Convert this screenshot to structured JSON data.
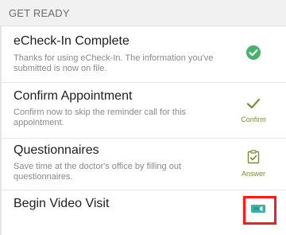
{
  "section": {
    "header": "GET READY"
  },
  "rows": [
    {
      "title": "eCheck-In Complete",
      "subtitle": "Thanks for using eCheck-In. The information you've submitted is now on file.",
      "icon": "check-circle-icon"
    },
    {
      "title": "Confirm Appointment",
      "subtitle": "Confirm now to skip the reminder call for this appointment.",
      "icon": "checkmark-icon",
      "action_label": "Confirm"
    },
    {
      "title": "Questionnaires",
      "subtitle": "Save time at the doctor's office by filling out questionnaires.",
      "icon": "clipboard-check-icon",
      "action_label": "Answer"
    },
    {
      "title": "Begin Video Visit",
      "icon": "video-camera-icon"
    }
  ],
  "colors": {
    "success_green": "#45b36b",
    "action_olive": "#7d8b36",
    "video_teal": "#39b3a7",
    "highlight_red": "#ff1a1a"
  }
}
